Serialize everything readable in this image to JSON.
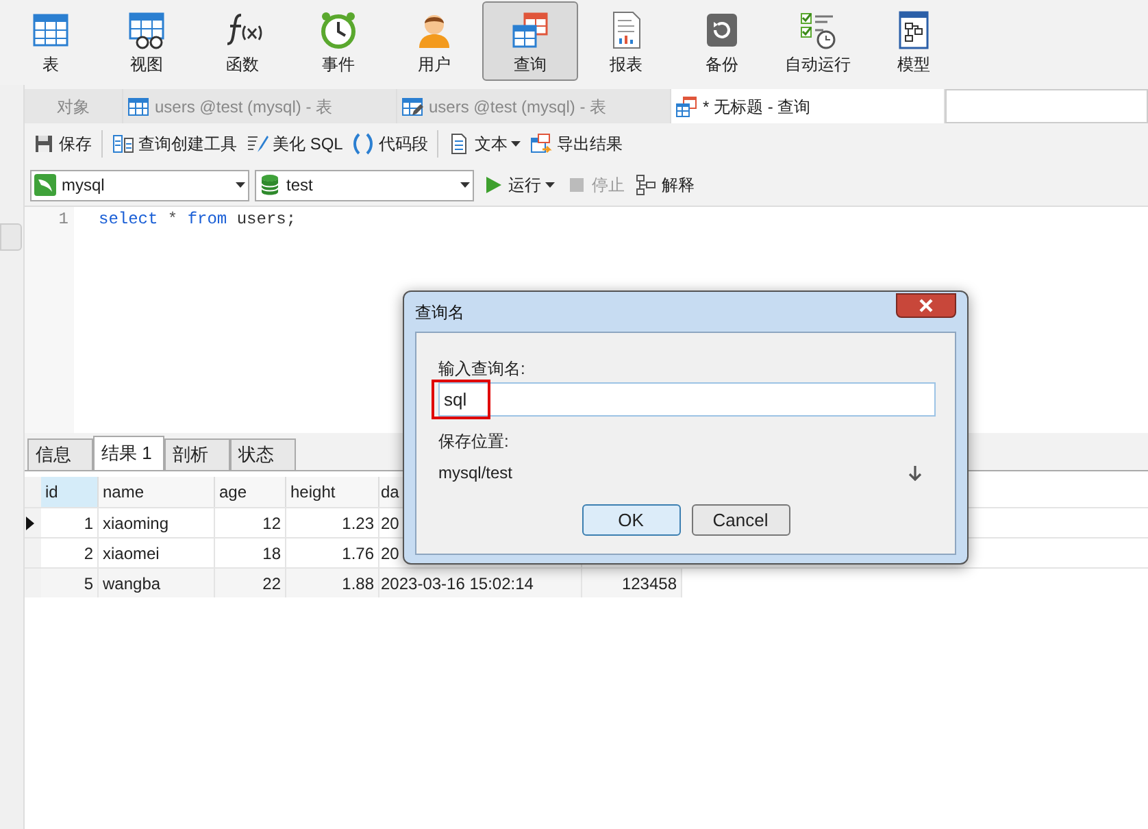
{
  "toolbar": {
    "items": [
      {
        "label": "表",
        "kind": "table",
        "selected": false
      },
      {
        "label": "视图",
        "kind": "view",
        "selected": false
      },
      {
        "label": "函数",
        "kind": "function",
        "selected": false
      },
      {
        "label": "事件",
        "kind": "event",
        "selected": false
      },
      {
        "label": "用户",
        "kind": "user",
        "selected": false
      },
      {
        "label": "查询",
        "kind": "query",
        "selected": true
      },
      {
        "label": "报表",
        "kind": "report",
        "selected": false
      },
      {
        "label": "备份",
        "kind": "backup",
        "selected": false
      },
      {
        "label": "自动运行",
        "kind": "schedule",
        "selected": false
      },
      {
        "label": "模型",
        "kind": "model",
        "selected": false
      }
    ]
  },
  "tabs": [
    {
      "label": "对象",
      "kind": "plain",
      "selected": false
    },
    {
      "label": "users @test (mysql) - 表",
      "kind": "table",
      "selected": false
    },
    {
      "label": "users @test (mysql) - 表",
      "kind": "design",
      "selected": false
    },
    {
      "label": "* 无标题 - 查询",
      "kind": "query",
      "selected": true
    }
  ],
  "query_toolbar": {
    "buttons": [
      {
        "label": "保存",
        "kind": "save",
        "dropdown": false
      },
      {
        "label": "查询创建工具",
        "kind": "builder",
        "dropdown": false
      },
      {
        "label": "美化 SQL",
        "kind": "beautify",
        "dropdown": false
      },
      {
        "label": "代码段",
        "kind": "snippet",
        "dropdown": false
      },
      {
        "label": "文本",
        "kind": "text",
        "dropdown": true
      },
      {
        "label": "导出结果",
        "kind": "export",
        "dropdown": false
      }
    ]
  },
  "selectors": {
    "connection": "mysql",
    "database": "test"
  },
  "run_buttons": [
    {
      "label": "运行",
      "kind": "run",
      "dropdown": true,
      "disabled": false
    },
    {
      "label": "停止",
      "kind": "stop",
      "dropdown": false,
      "disabled": true
    },
    {
      "label": "解释",
      "kind": "explain",
      "dropdown": false,
      "disabled": false
    }
  ],
  "editor": {
    "lines": [
      {
        "number": "1",
        "tokens": [
          {
            "text": "select",
            "kind": "keyword"
          },
          {
            "text": "*",
            "kind": "operator"
          },
          {
            "text": "from",
            "kind": "keyword"
          },
          {
            "text": "users;",
            "kind": "plain"
          }
        ]
      }
    ]
  },
  "result_tabs": [
    {
      "label": "信息",
      "selected": false
    },
    {
      "label": "结果 1",
      "selected": true
    },
    {
      "label": "剖析",
      "selected": false
    },
    {
      "label": "状态",
      "selected": false
    }
  ],
  "table": {
    "columns": [
      "id",
      "name",
      "age",
      "height",
      "da"
    ],
    "rows": [
      {
        "current": true,
        "cells": [
          "1",
          "xiaoming",
          "12",
          "1.23",
          "20"
        ]
      },
      {
        "current": false,
        "cells": [
          "2",
          "xiaomei",
          "18",
          "1.76",
          "20"
        ]
      },
      {
        "current": false,
        "cells": [
          "5",
          "wangba",
          "22",
          "1.88",
          "2023-03-16 15:02:14",
          "123458"
        ]
      }
    ]
  },
  "dialog": {
    "title": "查询名",
    "name_label": "输入查询名:",
    "name_value": "sql",
    "name_highlighted": true,
    "location_label": "保存位置:",
    "location": "mysql/test",
    "buttons": [
      {
        "label": "OK",
        "default": true
      },
      {
        "label": "Cancel",
        "default": false
      }
    ]
  }
}
